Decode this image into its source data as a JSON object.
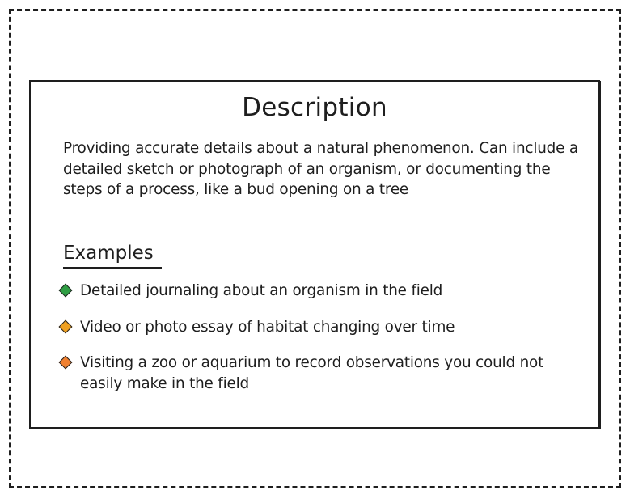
{
  "card": {
    "title": "Description",
    "description": "Providing accurate details about a natural phenomenon. Can include a detailed sketch or photograph of an organism, or documenting the steps of a process, like a bud opening on a tree",
    "examples_heading": "Examples",
    "examples": [
      {
        "text": "Detailed journaling about an organism in the field",
        "color": "#2f9e44"
      },
      {
        "text": "Video or photo essay of habitat changing over time",
        "color": "#f0a020"
      },
      {
        "text": "Visiting a zoo or aquarium to record observations you could not easily make in the field",
        "color": "#f08030"
      }
    ]
  }
}
